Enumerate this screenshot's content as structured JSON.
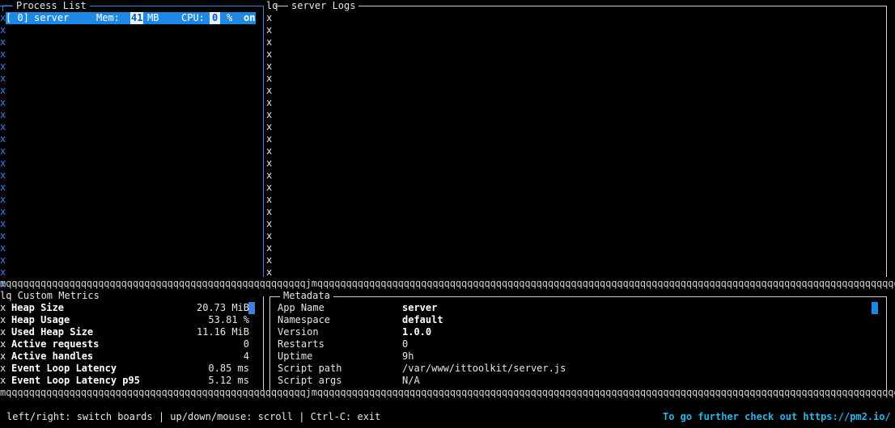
{
  "process_list": {
    "title": "Process List",
    "row": {
      "id": "[ 0]",
      "name": "server",
      "mem_label": "Mem:",
      "mem_value": "41",
      "mem_unit": "MB",
      "cpu_label": "CPU:",
      "cpu_value": "0",
      "cpu_unit": "%",
      "status": "on"
    }
  },
  "logs": {
    "prefix": "lq—",
    "title": "server Logs"
  },
  "metrics": {
    "title": "lq Custom Metrics",
    "items": [
      {
        "name": "Heap Size",
        "value": "20.73 MiB"
      },
      {
        "name": "Heap Usage",
        "value": "53.81 %"
      },
      {
        "name": "Used Heap Size",
        "value": "11.16 MiB"
      },
      {
        "name": "Active requests",
        "value": "0"
      },
      {
        "name": "Active handles",
        "value": "4"
      },
      {
        "name": "Event Loop Latency",
        "value": "0.85 ms"
      },
      {
        "name": "Event Loop Latency p95",
        "value": "5.12 ms"
      }
    ]
  },
  "metadata": {
    "title": "Metadata",
    "items": [
      {
        "key": "App Name",
        "value": "server",
        "bold": true
      },
      {
        "key": "Namespace",
        "value": "default",
        "bold": true
      },
      {
        "key": "Version",
        "value": "1.0.0",
        "bold": true
      },
      {
        "key": "Restarts",
        "value": "0",
        "bold": false
      },
      {
        "key": "Uptime",
        "value": "9h",
        "bold": false
      },
      {
        "key": "Script path",
        "value": "/var/www/ittoolkit/server.js",
        "bold": false
      },
      {
        "key": "Script args",
        "value": "N/A",
        "bold": false
      }
    ]
  },
  "footer": {
    "help": "left/right: switch boards | up/down/mouse: scroll | Ctrl-C: exit",
    "promo": "To go further check out https://pm2.io/"
  },
  "colors": {
    "selection": "#1e88e5",
    "active_border": "#3f7fe0",
    "link": "#27b6e8"
  }
}
